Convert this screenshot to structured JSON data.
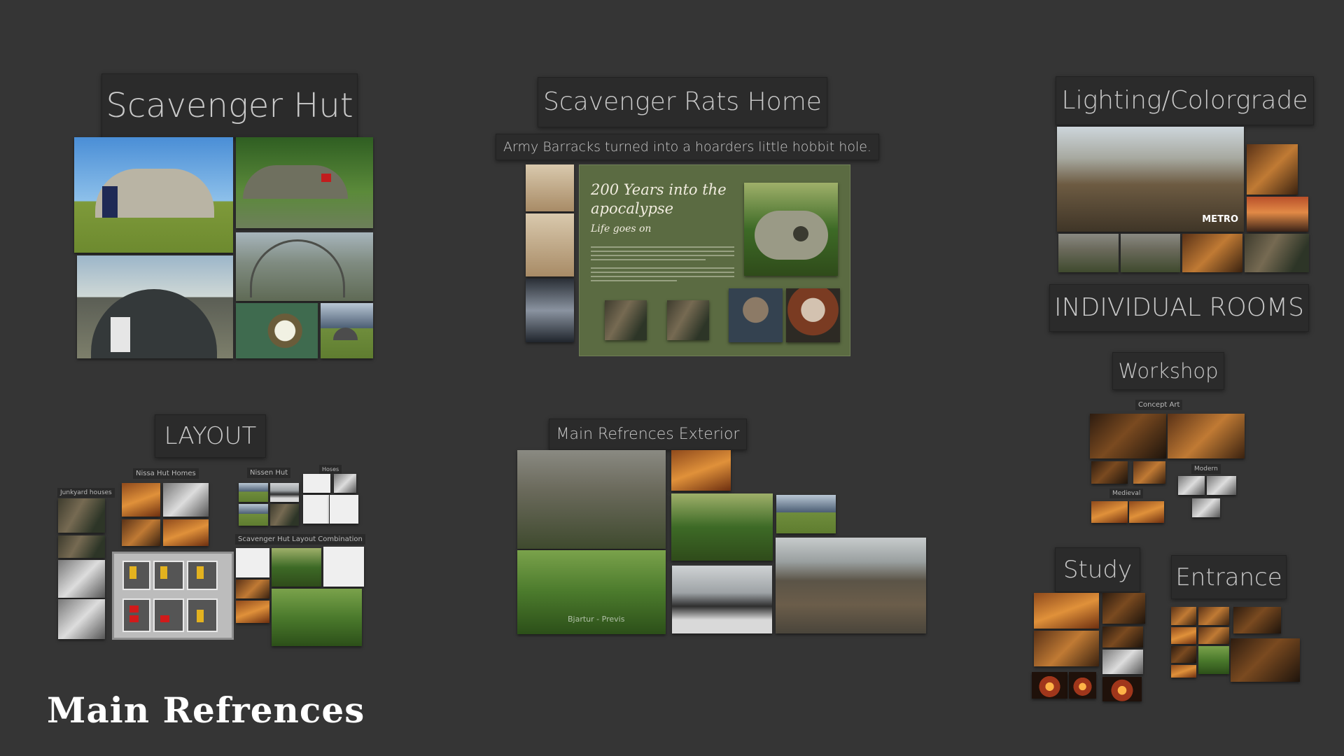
{
  "sections": {
    "scavenger_hut": "Scavenger Hut",
    "rats_home": "Scavenger Rats Home",
    "rats_home_caption": "Army Barracks turned into a hoarders little hobbit hole.",
    "lighting": "Lighting/Colorgrade",
    "individual_rooms": "INDIVIDUAL ROOMS",
    "workshop": "Workshop",
    "layout": "LAYOUT",
    "exterior": "Main Refrences Exterior",
    "study": "Study",
    "entrance": "Entrance",
    "footer": "Main Refrences"
  },
  "mood_board": {
    "title": "200 Years into the apocalypse",
    "subtitle": "Life goes on"
  },
  "layout_tags": {
    "junkyard": "Junkyard houses",
    "nissa": "Nissa Hut Homes",
    "nissen": "Nissen Hut",
    "hoses": "Hoses",
    "combination": "Scavenger Hut Layout Combination"
  },
  "workshop_tags": {
    "concept": "Concept Art",
    "modern": "Modern",
    "medieval": "Medieval"
  },
  "exterior_caption": "Bjartur - Previs",
  "metro_logo": "METRO"
}
